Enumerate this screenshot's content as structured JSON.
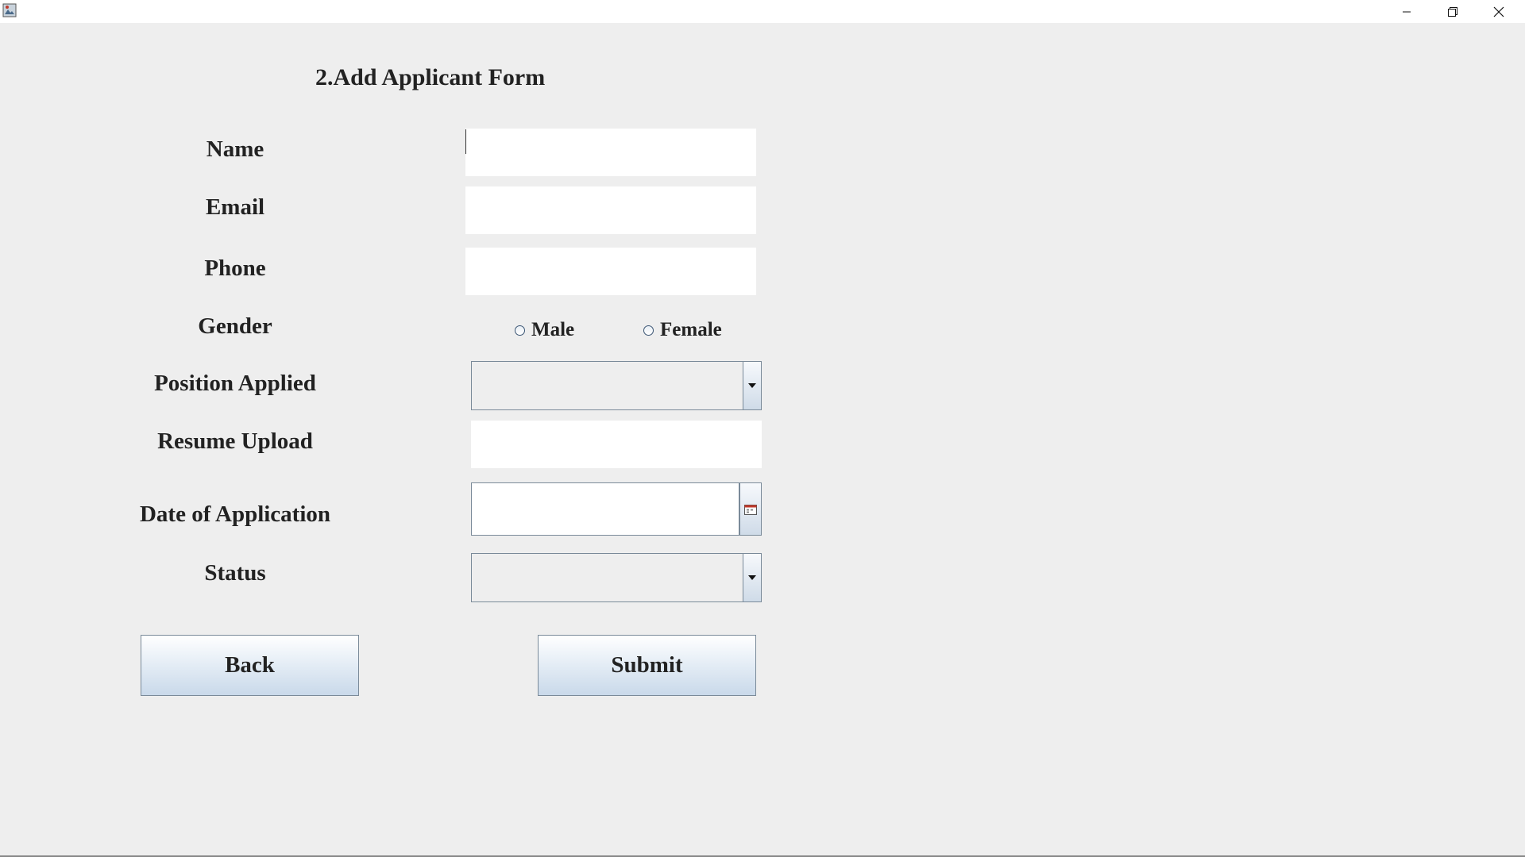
{
  "form": {
    "title": "2.Add Applicant Form",
    "labels": {
      "name": "Name",
      "email": "Email",
      "phone": "Phone",
      "gender": "Gender",
      "position": "Position Applied",
      "resume": "Resume Upload",
      "date": "Date of Application",
      "status": "Status"
    },
    "values": {
      "name": "",
      "email": "",
      "phone": "",
      "resume": "",
      "date": "",
      "position": "",
      "status": ""
    },
    "gender_options": [
      "Male",
      "Female"
    ],
    "buttons": {
      "back": "Back",
      "submit": "Submit"
    }
  },
  "icons": {
    "app": "java-app-icon",
    "minimize": "minimize-icon",
    "maximize": "restore-icon",
    "close": "close-icon",
    "combo_arrow": "chevron-down-icon",
    "calendar": "calendar-icon"
  }
}
